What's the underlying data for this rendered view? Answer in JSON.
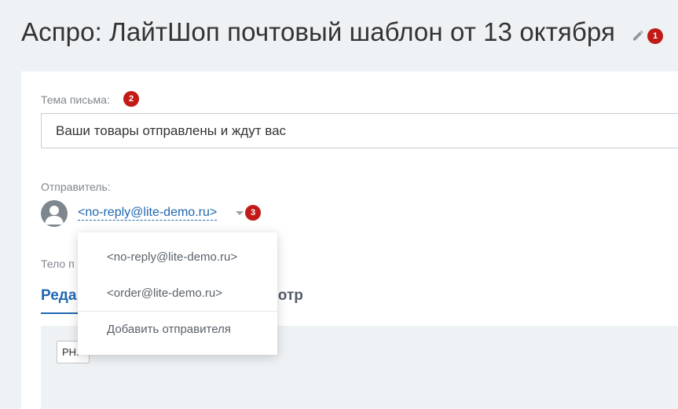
{
  "header": {
    "title": "Аспро: ЛайтШоп почтовый шаблон от 13 октября",
    "edit_icon": "pencil-icon",
    "badge": "1"
  },
  "subject": {
    "label": "Тема письма:",
    "badge": "2",
    "value": "Ваши товары отправлены и ждут вас"
  },
  "sender": {
    "label": "Отправитель:",
    "avatar_icon": "user-avatar-icon",
    "value": "<no-reply@lite-demo.ru>",
    "badge": "3",
    "caret_icon": "caret-down-icon"
  },
  "sender_dropdown": {
    "options": [
      "<no-reply@lite-demo.ru>",
      "<order@lite-demo.ru>"
    ],
    "add_label": "Добавить отправителя"
  },
  "body": {
    "label": "Тело п",
    "tabs": [
      {
        "label": "Реда",
        "active": true
      },
      {
        "label": "мотр",
        "active": false
      }
    ],
    "editor_button": "PH."
  },
  "colors": {
    "accent": "#2067b0",
    "badge": "#c21b17",
    "background": "#eef2f4"
  }
}
